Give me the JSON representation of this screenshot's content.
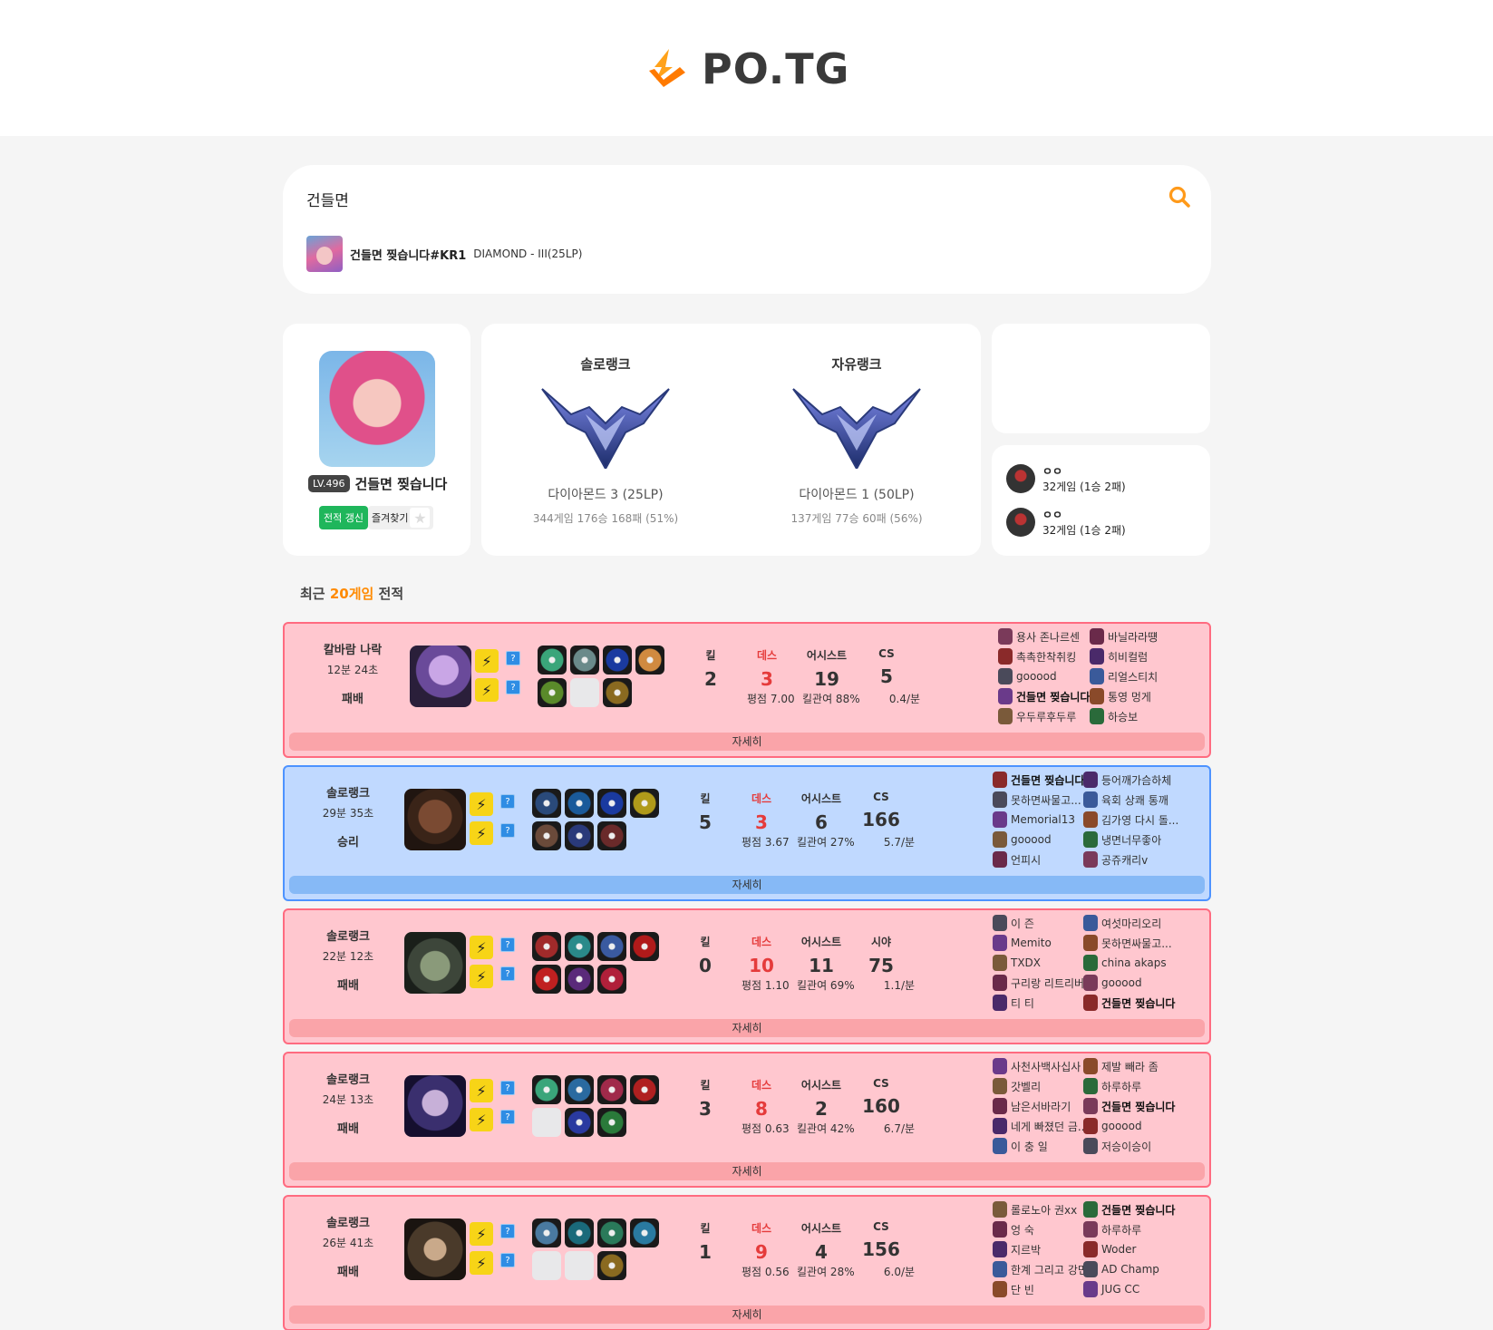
{
  "brand": {
    "name": "PO.TG"
  },
  "search": {
    "value": "건들면",
    "suggestion_name": "건들면 찢습니다#KR1",
    "suggestion_tier": "DIAMOND - III(25LP)"
  },
  "profile": {
    "level": "LV.496",
    "name": "건들면 찢습니다",
    "update_label": "전적 갱신",
    "favorite_label": "즐겨찾기"
  },
  "ranks": [
    {
      "title": "솔로랭크",
      "tier": "다이아몬드 3 (25LP)",
      "record": "344게임 176승 168패 (51%)"
    },
    {
      "title": "자유랭크",
      "tier": "다이아몬드 1 (50LP)",
      "record": "137게임 77승 60패 (56%)"
    }
  ],
  "duo": [
    {
      "name": "ㅇㅇ",
      "record": "32게임 (1승 2패)"
    },
    {
      "name": "ㅇㅇ",
      "record": "32게임 (1승 2패)"
    }
  ],
  "recent": {
    "prefix": "최근 ",
    "count": "20게임",
    "suffix": " 전적"
  },
  "colors": {
    "accent": "#ff8a00",
    "lose_bg": "#ffc7cf",
    "win_bg": "#c0d9ff",
    "death": "#e53b3b"
  },
  "matches": [
    {
      "mode": "칼바람 나락",
      "duration": "12분 24초",
      "result": "패배",
      "outcome": "lose",
      "labels": {
        "kill": "킬",
        "death": "데스",
        "assist": "어시스트",
        "fourth": "CS"
      },
      "kill": "2",
      "death": "3",
      "assist": "19",
      "fourth": "5",
      "rating": "평점 7.00",
      "kp": "킬관여 88%",
      "per_min": "0.4/분",
      "detail": "자세히",
      "team_a": [
        "용사 존나르센",
        "촉촉한착취킹",
        "gooood",
        "건들면 찢습니다",
        "우두루후두루"
      ],
      "team_b": [
        "바닐라라떙",
        "히비컬럼",
        "리얼스티치",
        "통영 멍게",
        "하승보"
      ],
      "me": "건들면 찢습니다"
    },
    {
      "mode": "솔로랭크",
      "duration": "29분 35초",
      "result": "승리",
      "outcome": "win",
      "labels": {
        "kill": "킬",
        "death": "데스",
        "assist": "어시스트",
        "fourth": "CS"
      },
      "kill": "5",
      "death": "3",
      "assist": "6",
      "fourth": "166",
      "rating": "평점 3.67",
      "kp": "킬관여 27%",
      "per_min": "5.7/분",
      "detail": "자세히",
      "team_a": [
        "건들면 찢습니다",
        "못하면싸물고...",
        "Memorial13",
        "gooood",
        "언피시"
      ],
      "team_b": [
        "등어깨가슴하체",
        "육회 상쾌 통깨",
        "김가영 다시 돌...",
        "냉면너무좋아",
        "공쥬캐리v"
      ],
      "me": "건들면 찢습니다"
    },
    {
      "mode": "솔로랭크",
      "duration": "22분 12초",
      "result": "패배",
      "outcome": "lose",
      "labels": {
        "kill": "킬",
        "death": "데스",
        "assist": "어시스트",
        "fourth": "시야"
      },
      "kill": "0",
      "death": "10",
      "assist": "11",
      "fourth": "75",
      "rating": "평점 1.10",
      "kp": "킬관여 69%",
      "per_min": "1.1/분",
      "detail": "자세히",
      "team_a": [
        "이 즌",
        "Memito",
        "TXDX",
        "구리랑 리트리버",
        "티 티"
      ],
      "team_b": [
        "여섯마리오리",
        "못하면싸물고...",
        "china akaps",
        "gooood",
        "건들면 찢습니다"
      ],
      "me": "건들면 찢습니다"
    },
    {
      "mode": "솔로랭크",
      "duration": "24분 13초",
      "result": "패배",
      "outcome": "lose",
      "labels": {
        "kill": "킬",
        "death": "데스",
        "assist": "어시스트",
        "fourth": "CS"
      },
      "kill": "3",
      "death": "8",
      "assist": "2",
      "fourth": "160",
      "rating": "평점 0.63",
      "kp": "킬관여 42%",
      "per_min": "6.7/분",
      "detail": "자세히",
      "team_a": [
        "사천사백사십사",
        "갓벨리",
        "남은서바라기",
        "네게 빠졌던 금...",
        "이 충 일"
      ],
      "team_b": [
        "제발 빼라 좀",
        "하루하루",
        "건들면 찢습니다",
        "gooood",
        "저승이승이"
      ],
      "me": "건들면 찢습니다"
    },
    {
      "mode": "솔로랭크",
      "duration": "26분 41초",
      "result": "패배",
      "outcome": "lose",
      "labels": {
        "kill": "킬",
        "death": "데스",
        "assist": "어시스트",
        "fourth": "CS"
      },
      "kill": "1",
      "death": "9",
      "assist": "4",
      "fourth": "156",
      "rating": "평점 0.56",
      "kp": "킬관여 28%",
      "per_min": "6.0/분",
      "detail": "자세히",
      "team_a": [
        "롤로노아 권xx",
        "엉 숙",
        "지르박",
        "한계 그리고 강민",
        "단 빈"
      ],
      "team_b": [
        "건들면 찢습니다",
        "하루하루",
        "Woder",
        "AD Champ",
        "JUG CC"
      ],
      "me": "건들면 찢습니다"
    }
  ]
}
